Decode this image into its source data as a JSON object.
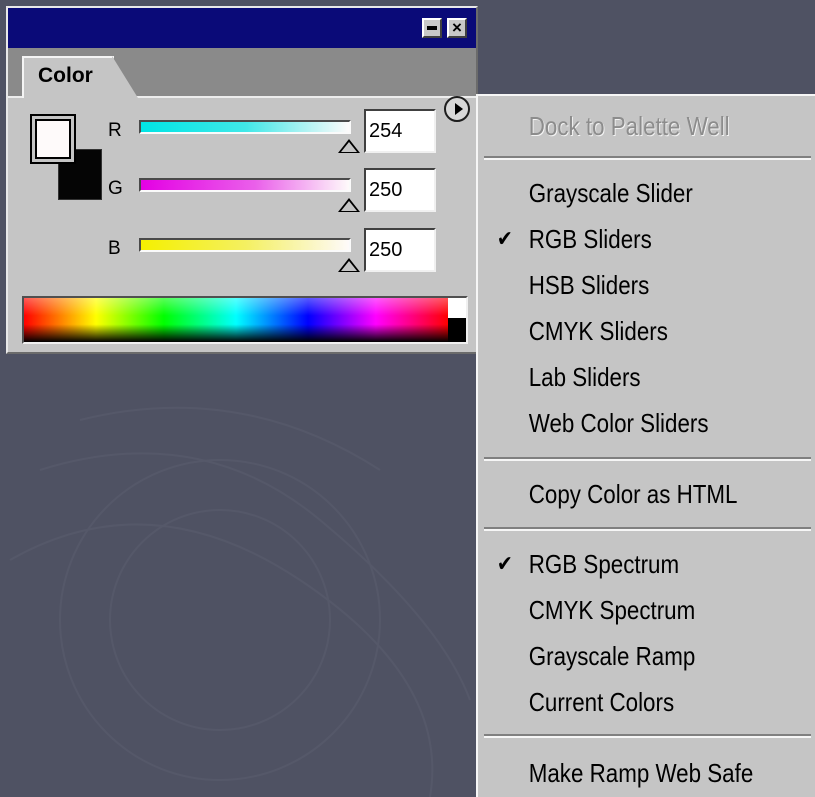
{
  "palette": {
    "tab_label": "Color",
    "channels": [
      {
        "label": "R",
        "value": "254",
        "level": 0.996
      },
      {
        "label": "G",
        "value": "250",
        "level": 0.98
      },
      {
        "label": "B",
        "value": "250",
        "level": 0.98
      }
    ],
    "foreground_color": "#FEFAFA",
    "background_color": "#000000",
    "spectrum_type": "RGB Spectrum"
  },
  "menu": {
    "items": [
      {
        "label": "Dock to Palette Well",
        "enabled": false,
        "checked": false
      },
      {
        "label": "Grayscale Slider",
        "enabled": true,
        "checked": false
      },
      {
        "label": "RGB Sliders",
        "enabled": true,
        "checked": true
      },
      {
        "label": "HSB Sliders",
        "enabled": true,
        "checked": false
      },
      {
        "label": "CMYK Sliders",
        "enabled": true,
        "checked": false
      },
      {
        "label": "Lab Sliders",
        "enabled": true,
        "checked": false
      },
      {
        "label": "Web Color Sliders",
        "enabled": true,
        "checked": false
      },
      {
        "label": "Copy Color as HTML",
        "enabled": true,
        "checked": false
      },
      {
        "label": "RGB Spectrum",
        "enabled": true,
        "checked": true
      },
      {
        "label": "CMYK Spectrum",
        "enabled": true,
        "checked": false
      },
      {
        "label": "Grayscale Ramp",
        "enabled": true,
        "checked": false
      },
      {
        "label": "Current Colors",
        "enabled": true,
        "checked": false
      },
      {
        "label": "Make Ramp Web Safe",
        "enabled": true,
        "checked": false
      }
    ],
    "check_glyph": "✔"
  },
  "icons": {
    "minimize": "minimize-icon",
    "close": "close-icon",
    "close_glyph": "×",
    "palette_menu": "palette-menu-arrow-icon"
  },
  "colors": {
    "title_bar": "#0A0A78",
    "desktop": "#4F5263",
    "panel": "#C5C5C5"
  }
}
